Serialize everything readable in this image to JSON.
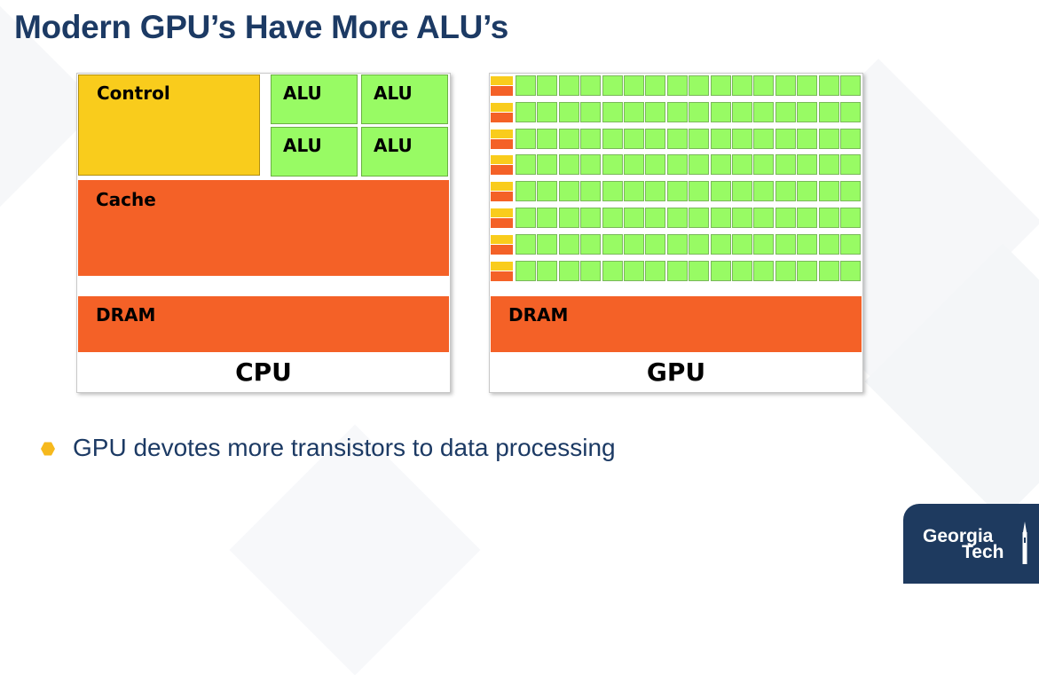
{
  "slide": {
    "title": "Modern GPU’s Have More ALU’s",
    "bullet": "GPU devotes more transistors to data processing",
    "logo": {
      "line1": "Georgia",
      "line2": "Tech",
      "icon": "tech-tower-icon"
    }
  },
  "cpu": {
    "label": "CPU",
    "control": "Control",
    "alus": [
      "ALU",
      "ALU",
      "ALU",
      "ALU"
    ],
    "cache": "Cache",
    "dram": "DRAM"
  },
  "gpu": {
    "label": "GPU",
    "dram": "DRAM",
    "rows": 8,
    "alus_per_row": 16
  },
  "colors": {
    "title": "#1c3a64",
    "control": "#f9cc1c",
    "alu": "#98fb64",
    "cache_dram": "#f46127",
    "bullet": "#f6b91d",
    "logo_bg": "#1e3a5f"
  }
}
